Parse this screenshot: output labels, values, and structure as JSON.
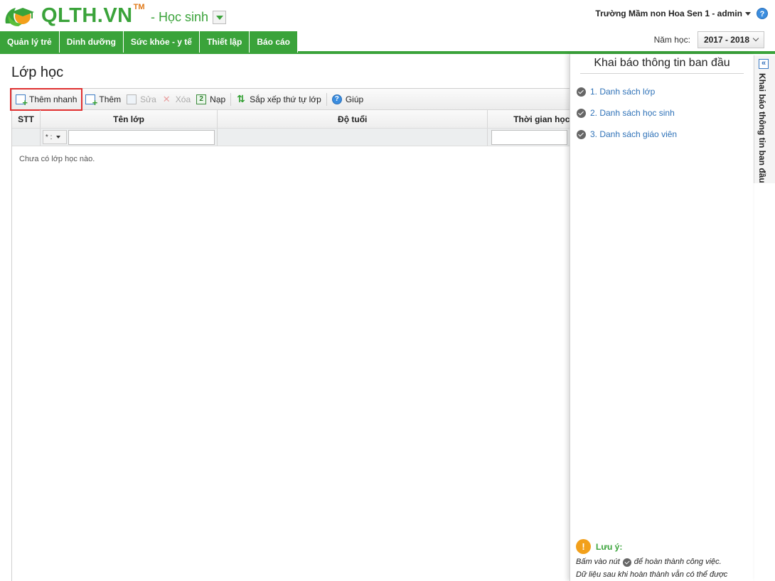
{
  "header": {
    "logo_text": "QLTH.VN",
    "logo_tm": "TM",
    "module_title": "- Học sinh",
    "user": "Trường Mầm non Hoa Sen 1 - admin",
    "help_glyph": "?"
  },
  "nav": {
    "tabs": [
      "Quản lý trẻ",
      "Dinh dưỡng",
      "Sức khỏe - y tế",
      "Thiết lập",
      "Báo cáo"
    ],
    "year_label": "Năm học:",
    "year_value": "2017 - 2018"
  },
  "page": {
    "title": "Lớp học"
  },
  "toolbar": {
    "quick_add": "Thêm nhanh",
    "add": "Thêm",
    "edit": "Sửa",
    "delete": "Xóa",
    "load": "Nạp",
    "sort": "Sắp xếp thứ tự lớp",
    "help": "Giúp"
  },
  "grid": {
    "columns": [
      "STT",
      "Tên lớp",
      "Độ tuổi",
      "Thời gian học"
    ],
    "filter_op": "* :",
    "empty_message": "Chưa có lớp học nào."
  },
  "side_panel": {
    "title": "Khai báo thông tin ban đầu",
    "steps": [
      "1. Danh sách lớp",
      "2. Danh sách học sinh",
      "3. Danh sách giáo viên"
    ],
    "note_title": "Lưu ý:",
    "note_line1_a": "Bấm vào nút",
    "note_line1_b": "để hoàn thành công việc.",
    "note_line2": "Dữ liệu sau khi hoàn thành vẫn có thể được",
    "collapsed_label": "Khai báo thông tin ban đầu",
    "collapse_glyph": "«"
  },
  "colors": {
    "brand_green": "#3aa33a",
    "link_blue": "#2f72b8",
    "highlight_red": "#e03030",
    "note_orange": "#f2a01b"
  },
  "icons": [
    "graduation-cap-icon",
    "plus-document-icon",
    "edit-icon",
    "delete-x-icon",
    "refresh-icon",
    "sort-icon",
    "help-circle-icon",
    "check-circle-icon",
    "info-icon",
    "collapse-chevrons-icon"
  ]
}
